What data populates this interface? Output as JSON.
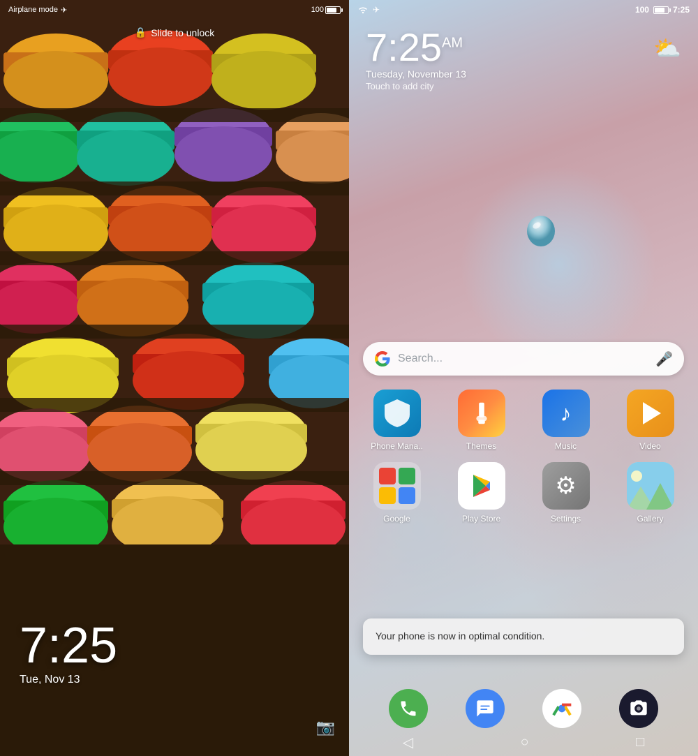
{
  "left": {
    "status_bar": {
      "airplane_mode": "Airplane mode",
      "airplane_icon": "✈",
      "battery": "100"
    },
    "slide_unlock": "Slide to unlock",
    "lock_icon": "🔒",
    "time": "7:25",
    "date": "Tue, Nov 13",
    "camera_icon": "📷"
  },
  "right": {
    "status_bar": {
      "wifi_icon": "wifi",
      "airplane_icon": "✈",
      "battery": "100",
      "time": "7:25"
    },
    "clock": {
      "time": "7:25",
      "am_pm": "AM",
      "date": "Tuesday, November 13",
      "city_prompt": "Touch to add city"
    },
    "weather": {
      "icon": "⛅"
    },
    "search": {
      "placeholder": "Search...",
      "mic_icon": "🎤"
    },
    "apps_row1": [
      {
        "id": "phone-manager",
        "label": "Phone Mana..",
        "icon_type": "phone-manager"
      },
      {
        "id": "themes",
        "label": "Themes",
        "icon_type": "themes"
      },
      {
        "id": "music",
        "label": "Music",
        "icon_type": "music"
      },
      {
        "id": "video",
        "label": "Video",
        "icon_type": "video"
      }
    ],
    "apps_row2": [
      {
        "id": "google",
        "label": "Google",
        "icon_type": "google-folder"
      },
      {
        "id": "play-store",
        "label": "Play Store",
        "icon_type": "play-store"
      },
      {
        "id": "settings",
        "label": "Settings",
        "icon_type": "settings"
      },
      {
        "id": "gallery",
        "label": "Gallery",
        "icon_type": "gallery"
      }
    ],
    "toast": {
      "message": "Your phone is now in optimal condition."
    },
    "dock": [
      {
        "id": "phone",
        "icon_type": "phone"
      },
      {
        "id": "messages",
        "icon_type": "messages"
      },
      {
        "id": "chrome",
        "icon_type": "chrome"
      },
      {
        "id": "camera",
        "icon_type": "camera"
      }
    ],
    "nav": {
      "back": "◁",
      "home": "○",
      "recent": "□"
    }
  }
}
